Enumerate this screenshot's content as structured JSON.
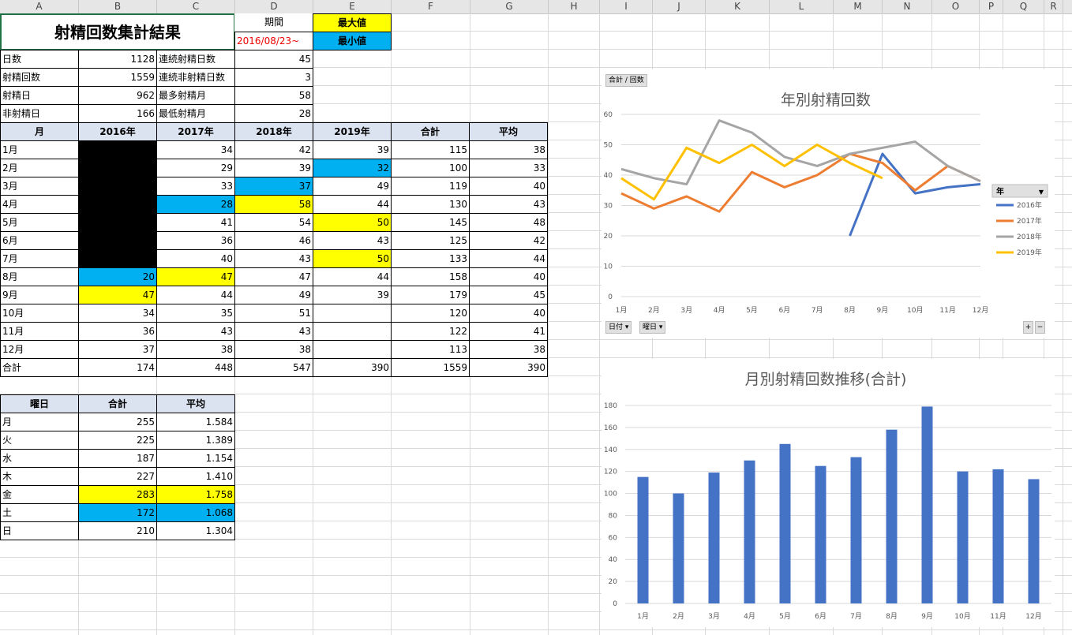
{
  "columns": [
    "A",
    "B",
    "C",
    "D",
    "E",
    "F",
    "G",
    "H",
    "I",
    "J",
    "K",
    "L",
    "M",
    "N",
    "O",
    "P",
    "Q",
    "R"
  ],
  "title": "射精回数集計結果",
  "period_label": "期間",
  "period_value": "2016/08/23~",
  "legend_max": "最大値",
  "legend_min": "最小値",
  "summary": [
    {
      "label": "日数",
      "value": "1128",
      "label2": "連続射精日数",
      "value2": "45"
    },
    {
      "label": "射精回数",
      "value": "1559",
      "label2": "連続非射精日数",
      "value2": "3"
    },
    {
      "label": "射精日",
      "value": "962",
      "label2": "最多射精月",
      "value2": "58"
    },
    {
      "label": "非射精日",
      "value": "166",
      "label2": "最低射精月",
      "value2": "28"
    }
  ],
  "monthly_headers": [
    "月",
    "2016年",
    "2017年",
    "2018年",
    "2019年",
    "合計",
    "平均"
  ],
  "monthly_rows": [
    [
      "1月",
      "",
      "34",
      "42",
      "39",
      "115",
      "38"
    ],
    [
      "2月",
      "",
      "29",
      "39",
      "32",
      "100",
      "33"
    ],
    [
      "3月",
      "",
      "33",
      "37",
      "49",
      "119",
      "40"
    ],
    [
      "4月",
      "",
      "28",
      "58",
      "44",
      "130",
      "43"
    ],
    [
      "5月",
      "",
      "41",
      "54",
      "50",
      "145",
      "48"
    ],
    [
      "6月",
      "",
      "36",
      "46",
      "43",
      "125",
      "42"
    ],
    [
      "7月",
      "",
      "40",
      "43",
      "50",
      "133",
      "44"
    ],
    [
      "8月",
      "20",
      "47",
      "47",
      "44",
      "158",
      "40"
    ],
    [
      "9月",
      "47",
      "44",
      "49",
      "39",
      "179",
      "45"
    ],
    [
      "10月",
      "34",
      "35",
      "51",
      "",
      "120",
      "40"
    ],
    [
      "11月",
      "36",
      "43",
      "43",
      "",
      "122",
      "41"
    ],
    [
      "12月",
      "37",
      "38",
      "38",
      "",
      "113",
      "38"
    ],
    [
      "合計",
      "174",
      "448",
      "547",
      "390",
      "1559",
      "390"
    ]
  ],
  "monthly_fill": [
    [
      "",
      "k",
      "",
      "",
      "",
      "",
      ""
    ],
    [
      "",
      "k",
      "",
      "",
      "b",
      "",
      ""
    ],
    [
      "",
      "k",
      "",
      "b",
      "",
      "",
      ""
    ],
    [
      "",
      "k",
      "b",
      "y",
      "",
      "",
      ""
    ],
    [
      "",
      "k",
      "",
      "",
      "y",
      "",
      ""
    ],
    [
      "",
      "k",
      "",
      "",
      "",
      "",
      ""
    ],
    [
      "",
      "k",
      "",
      "",
      "y",
      "",
      ""
    ],
    [
      "",
      "b",
      "y",
      "",
      "",
      "",
      ""
    ],
    [
      "",
      "y",
      "",
      "",
      "",
      "",
      ""
    ],
    [
      "",
      "",
      "",
      "",
      "",
      "",
      ""
    ],
    [
      "",
      "",
      "",
      "",
      "",
      "",
      ""
    ],
    [
      "",
      "",
      "",
      "",
      "",
      "",
      ""
    ],
    [
      "",
      "",
      "",
      "",
      "",
      "",
      ""
    ]
  ],
  "weekday_headers": [
    "曜日",
    "合計",
    "平均"
  ],
  "weekday_rows": [
    [
      "月",
      "255",
      "1.584"
    ],
    [
      "火",
      "225",
      "1.389"
    ],
    [
      "水",
      "187",
      "1.154"
    ],
    [
      "木",
      "227",
      "1.410"
    ],
    [
      "金",
      "283",
      "1.758"
    ],
    [
      "土",
      "172",
      "1.068"
    ],
    [
      "日",
      "210",
      "1.304"
    ]
  ],
  "weekday_fill": [
    [
      "",
      "",
      ""
    ],
    [
      "",
      "",
      ""
    ],
    [
      "",
      "",
      ""
    ],
    [
      "",
      "",
      ""
    ],
    [
      "",
      "y",
      "y"
    ],
    [
      "",
      "b",
      "b"
    ],
    [
      "",
      "",
      ""
    ]
  ],
  "chart_data": [
    {
      "type": "line",
      "title": "年別射精回数",
      "pivot_field_button": "合計 / 回数",
      "legend_header": "年",
      "legend_placement": "right",
      "filter_buttons": [
        "日付",
        "曜日"
      ],
      "zoom_buttons": [
        "+",
        "−"
      ],
      "x": [
        "1月",
        "2月",
        "3月",
        "4月",
        "5月",
        "6月",
        "7月",
        "8月",
        "9月",
        "10月",
        "11月",
        "12月"
      ],
      "ylim": [
        0,
        60
      ],
      "yticks": [
        0,
        10,
        20,
        30,
        40,
        50,
        60
      ],
      "grid": true,
      "series": [
        {
          "name": "2016年",
          "color": "#4472c4",
          "values": [
            null,
            null,
            null,
            null,
            null,
            null,
            null,
            20,
            47,
            34,
            36,
            37
          ]
        },
        {
          "name": "2017年",
          "color": "#ed7d31",
          "values": [
            34,
            29,
            33,
            28,
            41,
            36,
            40,
            47,
            44,
            35,
            43,
            38
          ]
        },
        {
          "name": "2018年",
          "color": "#a5a5a5",
          "values": [
            42,
            39,
            37,
            58,
            54,
            46,
            43,
            47,
            49,
            51,
            43,
            38
          ]
        },
        {
          "name": "2019年",
          "color": "#ffc000",
          "values": [
            39,
            32,
            49,
            44,
            50,
            43,
            50,
            44,
            39,
            null,
            null,
            null
          ]
        }
      ]
    },
    {
      "type": "bar",
      "title": "月別射精回数推移(合計)",
      "categories": [
        "1月",
        "2月",
        "3月",
        "4月",
        "5月",
        "6月",
        "7月",
        "8月",
        "9月",
        "10月",
        "11月",
        "12月"
      ],
      "values": [
        115,
        100,
        119,
        130,
        145,
        125,
        133,
        158,
        179,
        120,
        122,
        113
      ],
      "ylim": [
        0,
        180
      ],
      "yticks": [
        0,
        20,
        40,
        60,
        80,
        100,
        120,
        140,
        160,
        180
      ],
      "grid": true,
      "color": "#4472c4"
    }
  ]
}
